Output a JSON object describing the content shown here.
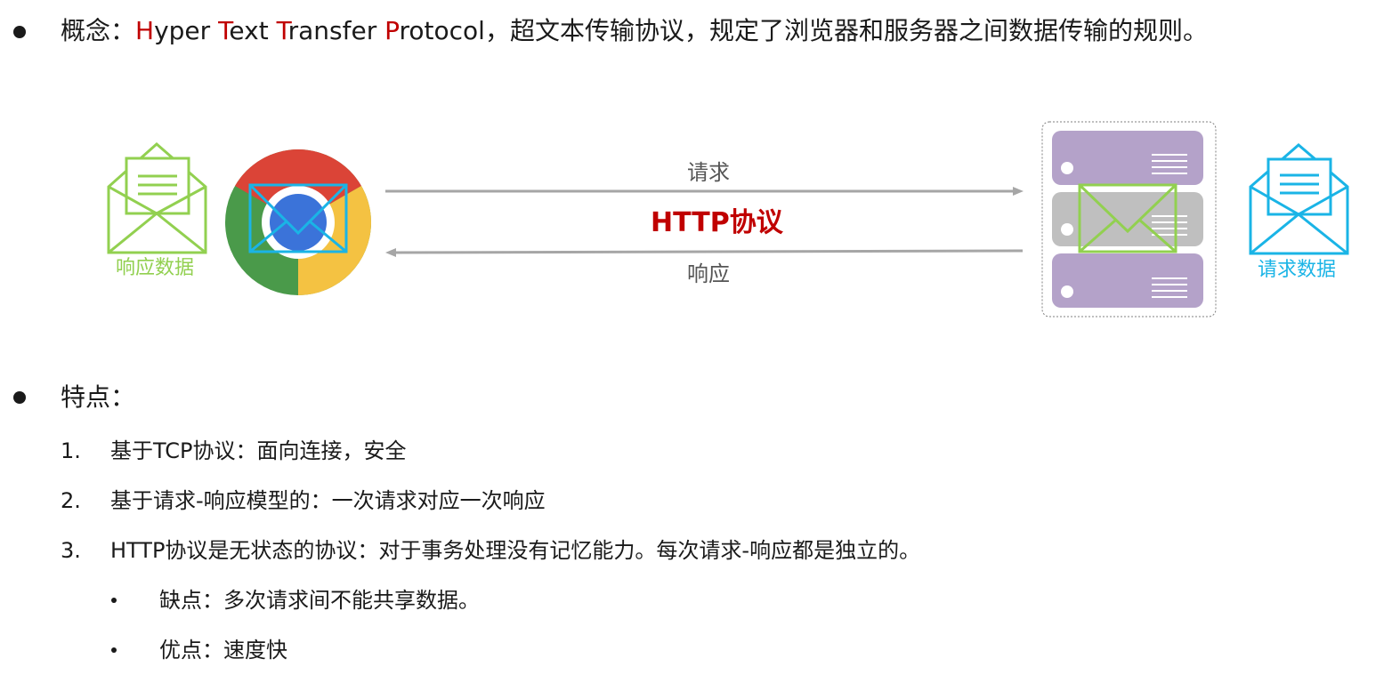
{
  "concept": {
    "label": "概念：",
    "protocol_words": [
      {
        "initial": "H",
        "rest": "yper "
      },
      {
        "initial": "T",
        "rest": "ext "
      },
      {
        "initial": "T",
        "rest": "ransfer "
      },
      {
        "initial": "P",
        "rest": "rotocol"
      }
    ],
    "definition": "，超文本传输协议，规定了浏览器和服务器之间数据传输的规则。"
  },
  "diagram": {
    "response_data_label": "响应数据",
    "request_data_label": "请求数据",
    "request_label": "请求",
    "protocol_label": "HTTP协议",
    "response_label": "响应",
    "colors": {
      "response_envelope": "#92d050",
      "request_envelope": "#1ab4e6",
      "protocol_text": "#c00000",
      "arrow": "#a6a6a6",
      "server_purple": "#b4a2c9",
      "server_gray": "#bfbfbf"
    },
    "icons": [
      "open-envelope-icon",
      "chrome-browser-icon",
      "server-icon",
      "closed-envelope-icon"
    ]
  },
  "features": {
    "title": "特点：",
    "items": [
      {
        "num": "1.",
        "text": "基于TCP协议：面向连接，安全"
      },
      {
        "num": "2.",
        "text": "基于请求-响应模型的：一次请求对应一次响应"
      },
      {
        "num": "3.",
        "text": "HTTP协议是无状态的协议：对于事务处理没有记忆能力。每次请求-响应都是独立的。"
      }
    ],
    "sub_items": [
      {
        "text": "缺点：多次请求间不能共享数据。"
      },
      {
        "text": "优点：速度快"
      }
    ]
  }
}
